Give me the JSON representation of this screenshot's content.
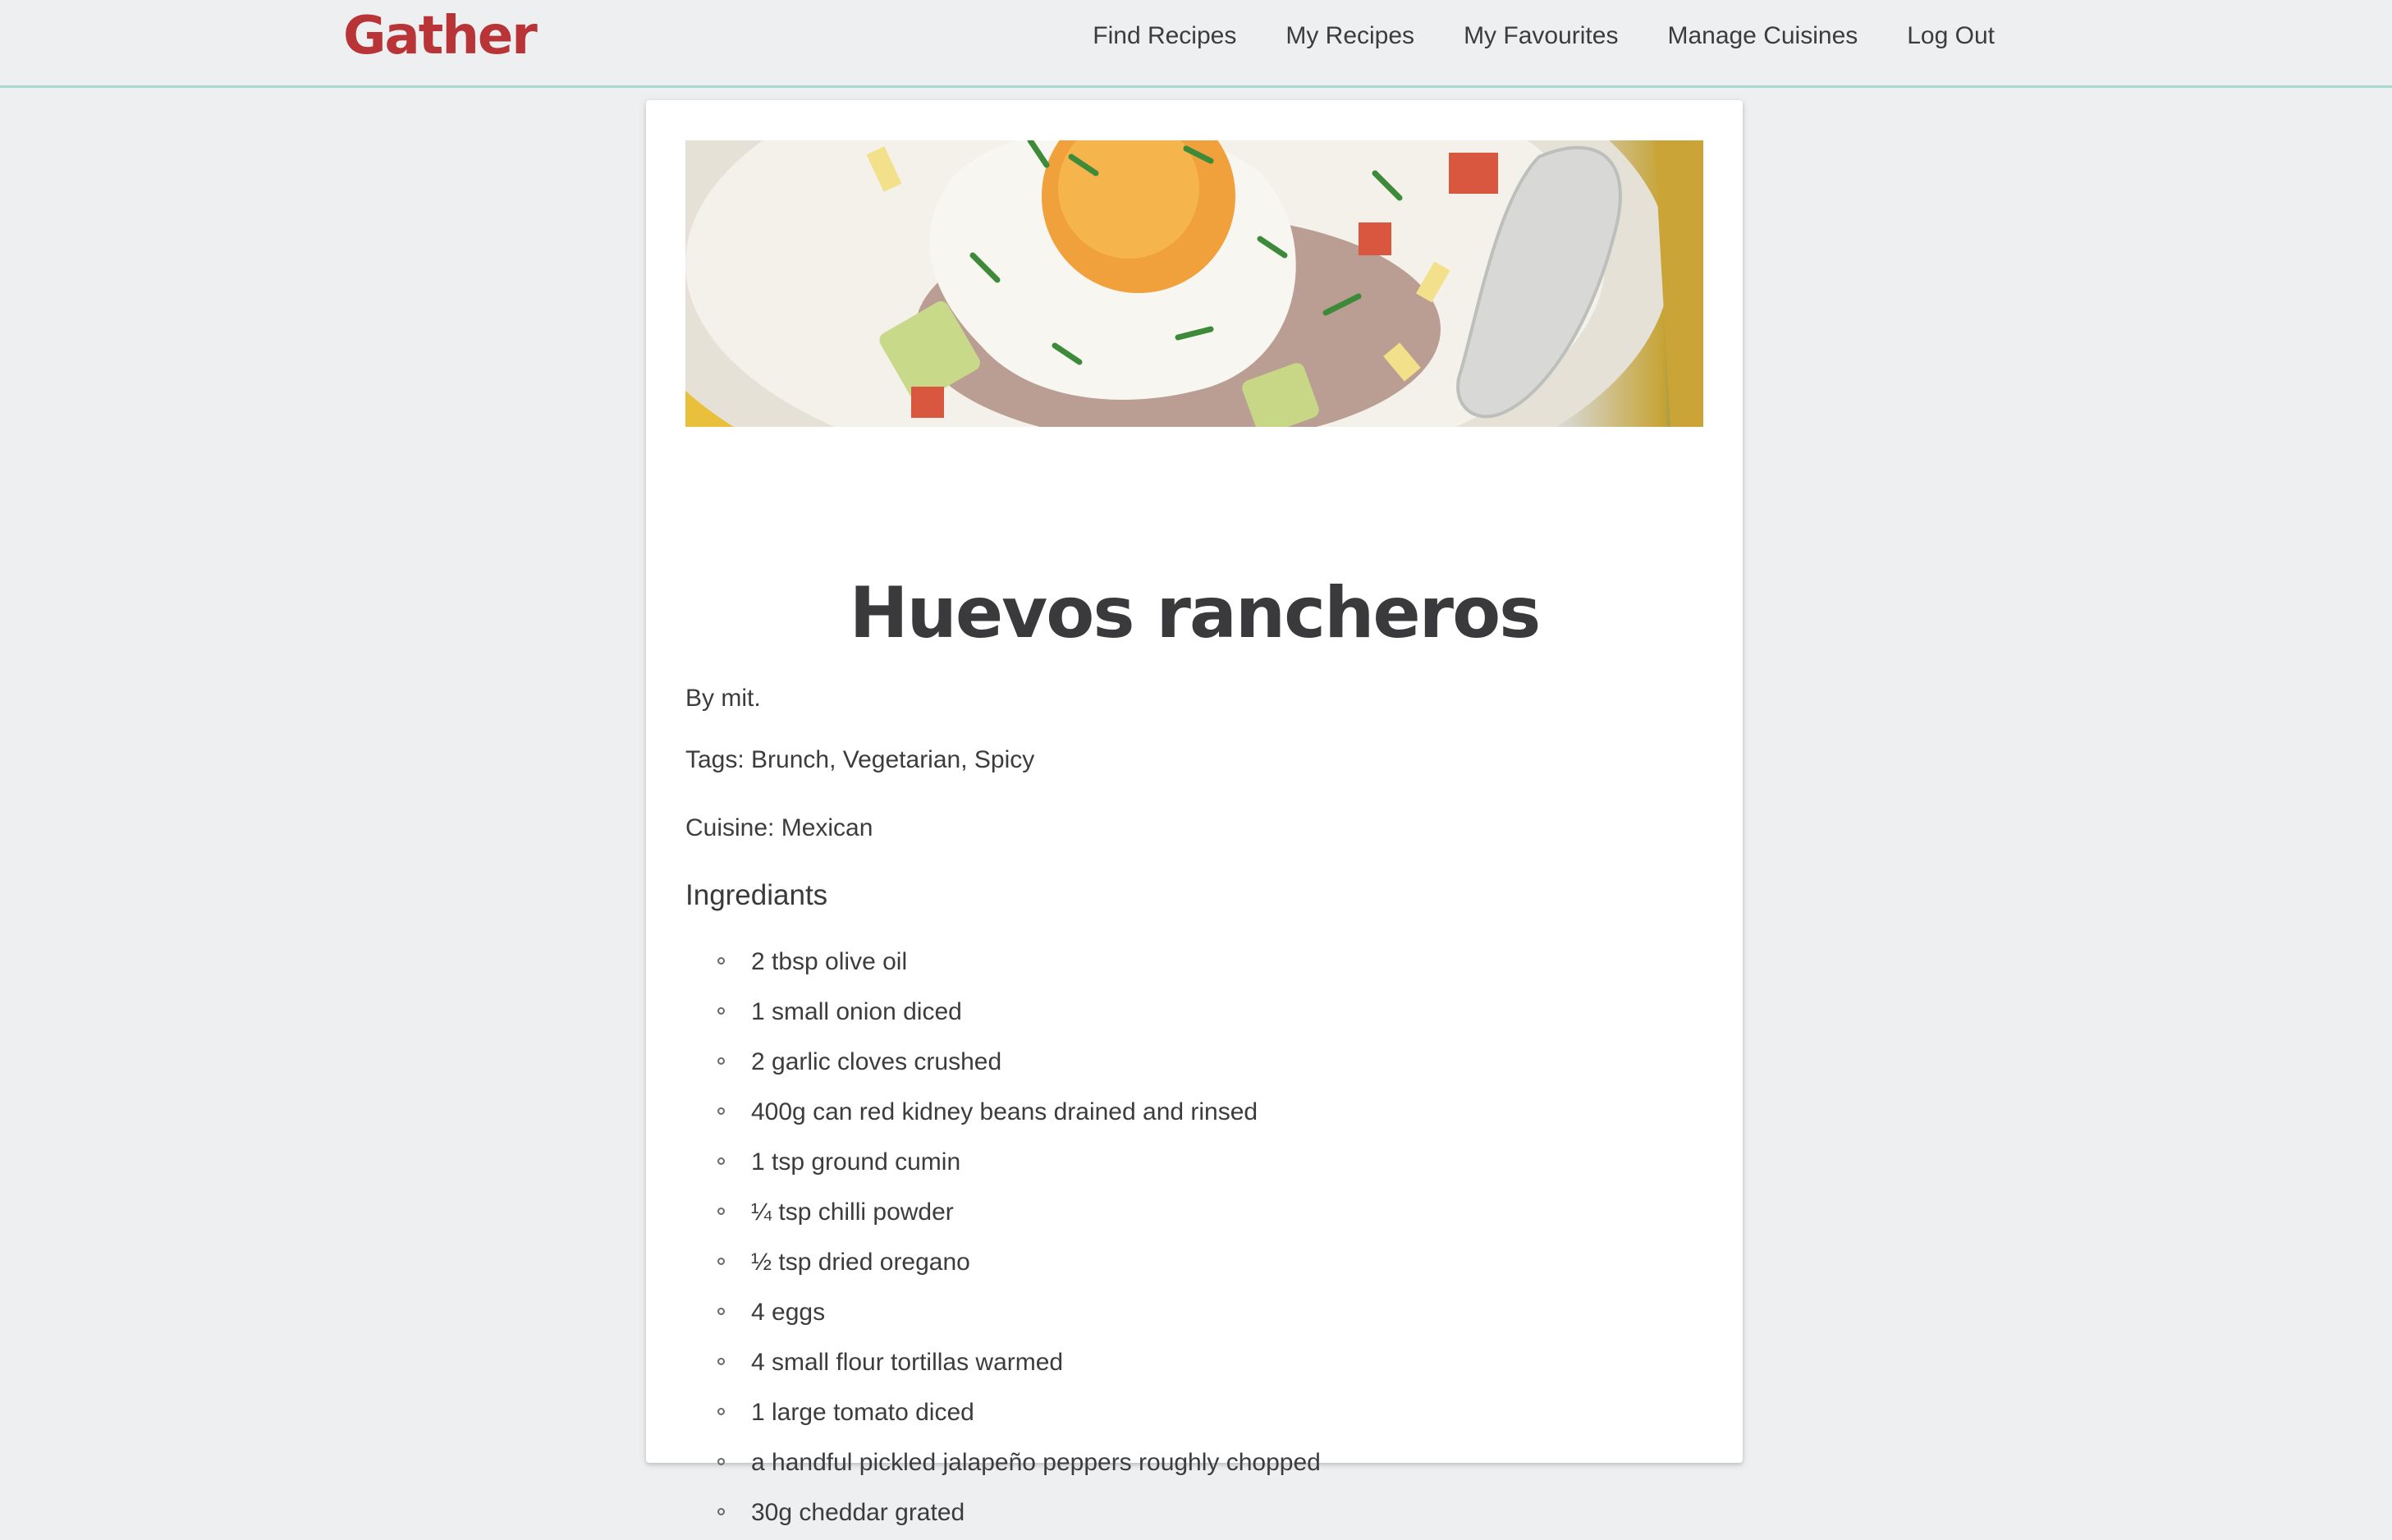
{
  "nav": {
    "brand": "Gather",
    "links": [
      {
        "label": "Find Recipes"
      },
      {
        "label": "My Recipes"
      },
      {
        "label": "My Favourites"
      },
      {
        "label": "Manage Cuisines"
      },
      {
        "label": "Log Out"
      }
    ]
  },
  "recipe": {
    "title": "Huevos rancheros",
    "author_line": "By mit.",
    "tags_line": "Tags: Brunch, Vegetarian, Spicy",
    "cuisine_line": "Cuisine: Mexican",
    "ingredients_heading": "Ingrediants",
    "ingredients": [
      "2 tbsp olive oil",
      "1 small onion diced",
      "2 garlic cloves crushed",
      "400g can red kidney beans drained and rinsed",
      "1 tsp ground cumin",
      "¼ tsp chilli powder",
      "½ tsp dried oregano",
      "4 eggs",
      "4 small flour tortillas warmed",
      "1 large tomato diced",
      "a handful pickled jalapeño peppers roughly chopped",
      "30g cheddar grated"
    ]
  },
  "colors": {
    "brand": "#b83437",
    "nav_border": "#a6d8cb",
    "page_bg": "#eeeff1",
    "text": "#3a3a3c"
  }
}
